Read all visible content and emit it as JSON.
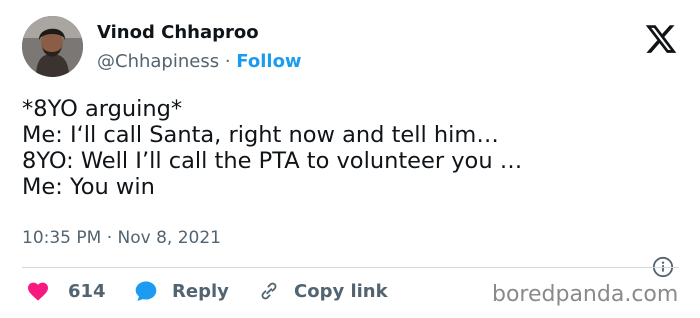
{
  "author": {
    "display_name": "Vinod Chhaproo",
    "handle": "@Chhapiness",
    "separator": "·",
    "follow_label": "Follow"
  },
  "tweet": {
    "lines": [
      "*8YO arguing*",
      "Me: I‘ll call Santa, right now and tell him…",
      "8YO: Well I’ll call the PTA to volunteer you …",
      "Me: You win"
    ],
    "timestamp": "10:35 PM · Nov 8, 2021"
  },
  "actions": {
    "like_count": "614",
    "reply_label": "Reply",
    "copy_link_label": "Copy link"
  },
  "watermark": "boredpanda.com",
  "colors": {
    "text": "#0f1419",
    "muted": "#536471",
    "accent": "#1d9bf0",
    "like": "#f91880",
    "divider": "#cfd9de"
  },
  "icons": {
    "brand": "x-logo-icon",
    "info": "info-icon",
    "like": "heart-icon",
    "reply": "speech-bubble-icon",
    "copy": "link-icon"
  }
}
